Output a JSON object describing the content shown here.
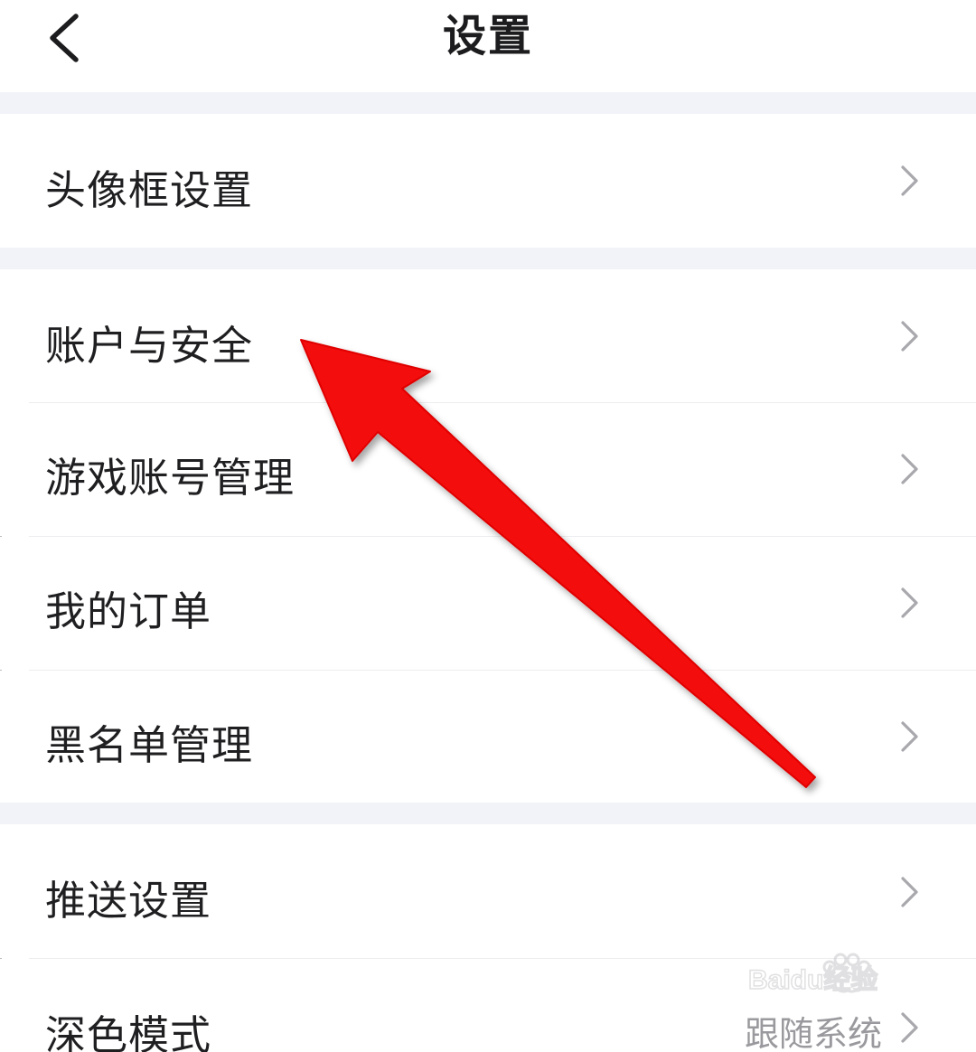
{
  "header": {
    "title": "设置",
    "back_icon": "chevron-left-icon"
  },
  "settings": {
    "avatar_frame": {
      "label": "头像框设置"
    },
    "account_security": {
      "label": "账户与安全"
    },
    "game_accounts": {
      "label": "游戏账号管理"
    },
    "my_orders": {
      "label": "我的订单"
    },
    "blacklist": {
      "label": "黑名单管理"
    },
    "push": {
      "label": "推送设置"
    },
    "dark_mode": {
      "label": "深色模式",
      "value": "跟随系统"
    }
  },
  "annotation": {
    "arrow_color": "#f40a0a"
  },
  "watermark": {
    "text": "Baidu经验"
  },
  "colors": {
    "background": "#ffffff",
    "section_gap": "#f2f3f8",
    "text": "#1f1f21",
    "chevron": "#a8a8ad"
  }
}
